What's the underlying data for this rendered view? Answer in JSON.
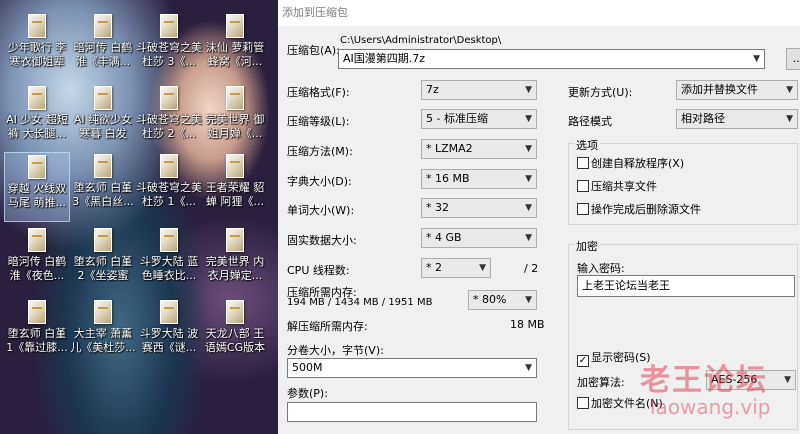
{
  "desktop": {
    "icons": [
      {
        "label": "少年歌行 李寒衣御姐辈"
      },
      {
        "label": "暗河传 白鹤淮《丰满..."
      },
      {
        "label": "斗破苍穹之美杜莎 3《..."
      },
      {
        "label": "沫仙 萝莉管 蜂窝《河..."
      },
      {
        "label": "AI 少女 超短 裤 大长腿..."
      },
      {
        "label": "AI 纯欲少女 寒暮 白发"
      },
      {
        "label": "斗破苍穹之美杜莎 2《..."
      },
      {
        "label": "完美世界 御姐月婵《..."
      },
      {
        "label": "穿越 火线双马尾 萌推..."
      },
      {
        "label": "堕玄师 白堇 3《黑白丝..."
      },
      {
        "label": "斗破苍穹之美杜莎 1《..."
      },
      {
        "label": "王者荣耀 貂蝉 阿狸《..."
      },
      {
        "label": "暗河传 白鹤淮《夜色..."
      },
      {
        "label": "堕玄师 白堇 2《坐姿蜜"
      },
      {
        "label": "斗罗大陆 蓝色睡衣比..."
      },
      {
        "label": "完美世界 内衣月婵定..."
      },
      {
        "label": "堕玄师 白堇 1《靠过膝..."
      },
      {
        "label": "大主宰 萧薰 儿《美杜莎..."
      },
      {
        "label": "斗罗大陆 波赛西《谜..."
      },
      {
        "label": "天龙八部 王语嫣CG版本"
      }
    ]
  },
  "dialog": {
    "title": "添加到压缩包",
    "archive_label": "压缩包(A):",
    "archive_path": "C:\\Users\\Administrator\\Desktop\\",
    "archive_name": "AI国漫第四期.7z",
    "browse_label": "...",
    "format_label": "压缩格式(F):",
    "format_value": "7z",
    "level_label": "压缩等级(L):",
    "level_value": "5 - 标准压缩",
    "method_label": "压缩方法(M):",
    "method_value": "* LZMA2",
    "dict_label": "字典大小(D):",
    "dict_value": "* 16 MB",
    "word_label": "单词大小(W):",
    "word_value": "* 32",
    "solid_label": "固实数据大小:",
    "solid_value": "* 4 GB",
    "threads_label": "CPU 线程数:",
    "threads_value": "* 2",
    "threads_total": "/ 2",
    "mem_label": "压缩所需内存:",
    "mem_values": "194 MB / 1434 MB / 1951 MB",
    "mem_percent": "* 80%",
    "decomp_label": "解压缩所需内存:",
    "decomp_value": "18 MB",
    "volume_label": "分卷大小，字节(V):",
    "volume_value": "500M",
    "params_label": "参数(P):",
    "params_value": "",
    "update_label": "更新方式(U):",
    "update_value": "添加并替换文件",
    "pathmode_label": "路径模式",
    "pathmode_value": "相对路径",
    "options_title": "选项",
    "opt_sfx": "创建自释放程序(X)",
    "opt_shared": "压缩共享文件",
    "opt_delete": "操作完成后删除源文件",
    "encrypt_title": "加密",
    "password_label": "输入密码:",
    "password_value": "上老王论坛当老王",
    "show_password": "显示密码(S)",
    "encrypt_method_label": "加密算法:",
    "encrypt_method_value": "AES-256",
    "encrypt_names": "加密文件名(N)"
  },
  "watermark": {
    "cn": "老王论坛",
    "url": "laowang.vip"
  }
}
